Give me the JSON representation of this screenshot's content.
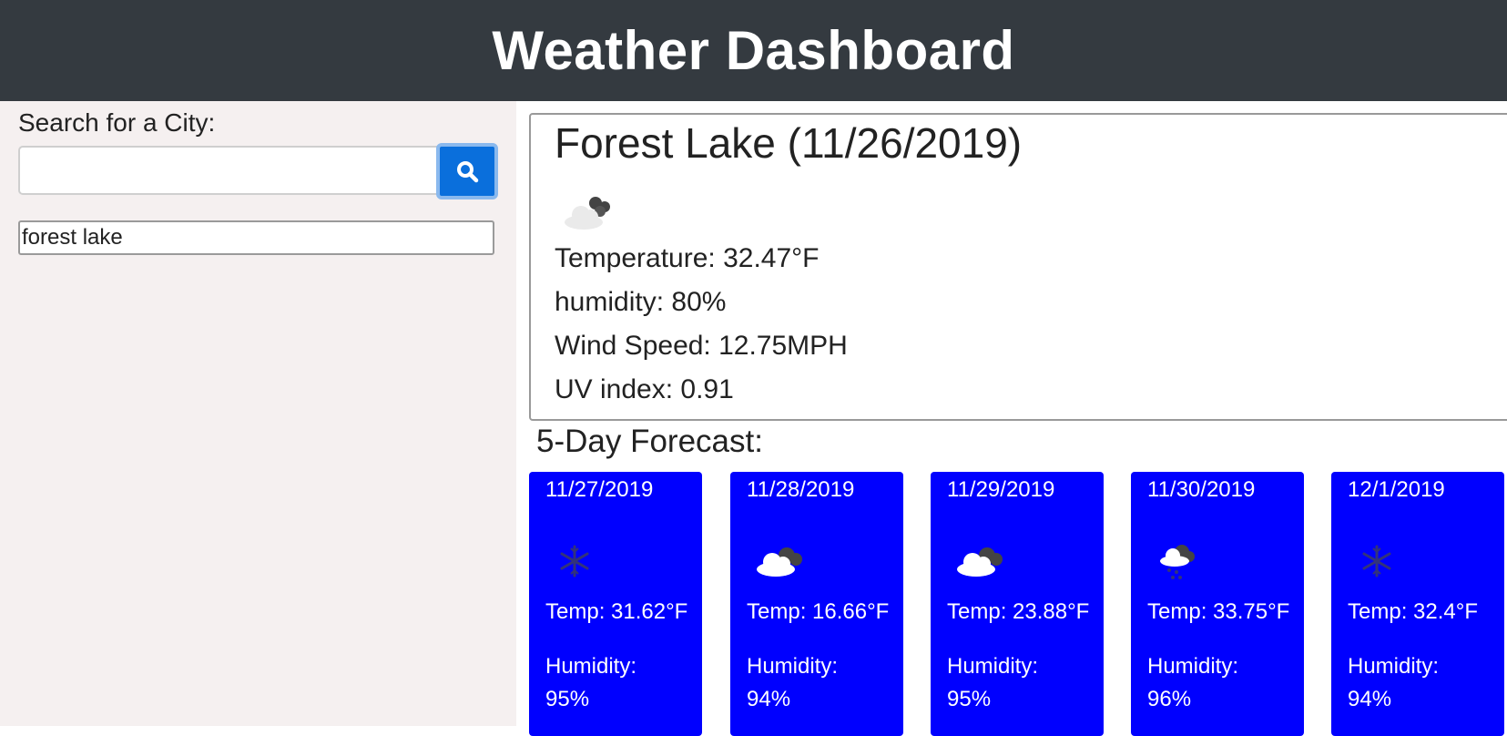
{
  "header": {
    "title": "Weather Dashboard"
  },
  "sidebar": {
    "label": "Search for a City:",
    "search": {
      "value": "",
      "placeholder": ""
    },
    "search_icon": "search-icon",
    "history": [
      "forest lake"
    ]
  },
  "current": {
    "title": "Forest Lake (11/26/2019)",
    "icon": "cloudy-icon",
    "temperature": "Temperature: 32.47°F",
    "humidity": "humidity: 80%",
    "wind": "Wind Speed: 12.75MPH",
    "uv": "UV index: 0.91"
  },
  "forecast": {
    "heading": "5-Day Forecast:",
    "card_color": "#0000ff",
    "days": [
      {
        "date": "11/27/2019",
        "icon": "snow-icon",
        "temp": "Temp: 31.62°F",
        "humidity_label": "Humidity:",
        "humidity_value": "95%"
      },
      {
        "date": "11/28/2019",
        "icon": "cloudy-icon",
        "temp": "Temp: 16.66°F",
        "humidity_label": "Humidity:",
        "humidity_value": "94%"
      },
      {
        "date": "11/29/2019",
        "icon": "cloudy-icon",
        "temp": "Temp: 23.88°F",
        "humidity_label": "Humidity:",
        "humidity_value": "95%"
      },
      {
        "date": "11/30/2019",
        "icon": "snow-cloud-icon",
        "temp": "Temp: 33.75°F",
        "humidity_label": "Humidity:",
        "humidity_value": "96%"
      },
      {
        "date": "12/1/2019",
        "icon": "snow-icon",
        "temp": "Temp: 32.4°F",
        "humidity_label": "Humidity:",
        "humidity_value": "94%"
      }
    ]
  }
}
